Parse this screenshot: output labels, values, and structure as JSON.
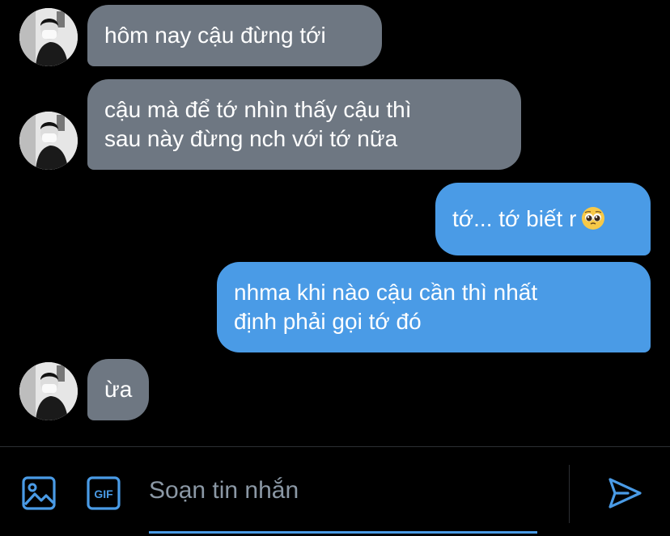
{
  "messages": [
    {
      "direction": "incoming",
      "lines": [
        "hôm nay cậu đừng tới"
      ]
    },
    {
      "direction": "incoming",
      "lines": [
        "cậu mà để tớ nhìn thấy cậu thì",
        "sau này đừng nch với tớ nữa"
      ]
    },
    {
      "direction": "outgoing",
      "lines": [
        "tớ... tớ biết r"
      ],
      "emoji": "pleading-face-emoji"
    },
    {
      "direction": "outgoing",
      "lines": [
        "nhma khi nào cậu cần thì nhất",
        "định phải gọi tớ đó"
      ]
    },
    {
      "direction": "incoming",
      "lines": [
        "ừa"
      ]
    }
  ],
  "composer": {
    "placeholder": "Soạn tin nhắn",
    "gif_label": "GIF",
    "icons": [
      "image-icon",
      "gif-icon",
      "send-icon"
    ]
  },
  "colors": {
    "background": "#000000",
    "incoming_bubble": "#6e7782",
    "outgoing_bubble": "#4a9be6",
    "accent": "#4a9be6",
    "placeholder": "#8b98a5"
  }
}
